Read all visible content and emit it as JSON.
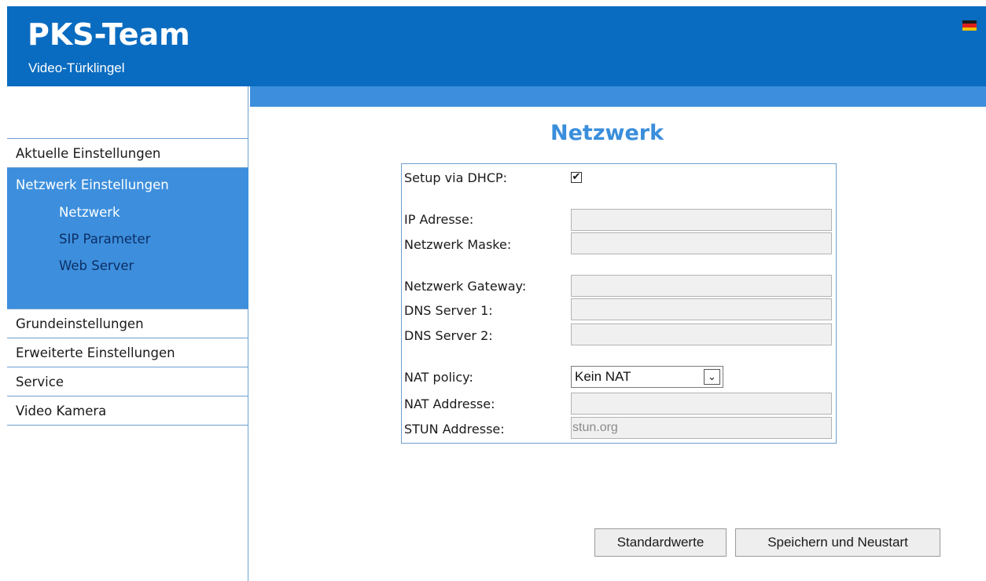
{
  "header": {
    "title": "PKS-Team",
    "subtitle": "Video-Türklingel",
    "language_flag": "german-flag-icon",
    "colors": {
      "bar": "#0a6cc0",
      "accent": "#3d8fdd",
      "title": "#3a8edb"
    }
  },
  "sidebar": {
    "items": [
      {
        "label": "Aktuelle Einstellungen"
      },
      {
        "label": "Netzwerk Einstellungen",
        "active": true,
        "children": [
          {
            "label": "Netzwerk",
            "active": true
          },
          {
            "label": "SIP Parameter"
          },
          {
            "label": "Web Server"
          }
        ]
      },
      {
        "label": "Grundeinstellungen"
      },
      {
        "label": "Erweiterte Einstellungen"
      },
      {
        "label": "Service"
      },
      {
        "label": "Video Kamera"
      }
    ]
  },
  "main": {
    "title": "Netzwerk",
    "form": {
      "dhcp_label": "Setup via DHCP:",
      "dhcp_checked": true,
      "ip_label": "IP Adresse:",
      "ip_value": "",
      "mask_label": "Netzwerk Maske:",
      "mask_value": "",
      "gateway_label": "Netzwerk Gateway:",
      "gateway_value": "",
      "dns1_label": "DNS Server 1:",
      "dns1_value": "",
      "dns2_label": "DNS Server 2:",
      "dns2_value": "",
      "nat_policy_label": "NAT policy:",
      "nat_policy_value": "Kein NAT",
      "nat_address_label": "NAT Addresse:",
      "nat_address_value": "",
      "stun_label": "STUN Addresse:",
      "stun_value": "stun.org"
    },
    "buttons": {
      "defaults": "Standardwerte",
      "save_restart": "Speichern und Neustart"
    }
  }
}
